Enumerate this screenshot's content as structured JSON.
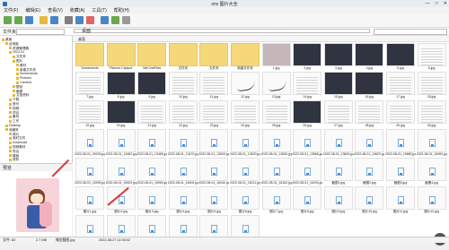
{
  "window": {
    "title": "xnv 图片大全",
    "minimize": "—",
    "maximize": "□",
    "close": "✕"
  },
  "menu": [
    "文件(F)",
    "编辑(E)",
    "查看(V)",
    "收藏(A)",
    "工具(T)",
    "帮助(H)"
  ],
  "address": {
    "label": "文件夹",
    "path": "桌面"
  },
  "tree": {
    "items": [
      "桌面",
      "此电脑",
      "资源管理器",
      "2022-01",
      "文件夹",
      "图片",
      "素材",
      "新建文件夹",
      "Screenshots",
      "Pictures",
      "Camera",
      "壁纸",
      "截图",
      "文档资料",
      "下载",
      "音乐",
      "视频",
      "项目",
      "备份",
      "工作",
      "Desktop",
      "收藏夹",
      "照片",
      "临时文件",
      "Download",
      "视频素材",
      "导出",
      "模板",
      "资料"
    ]
  },
  "preview": {
    "label": "预览"
  },
  "content": {
    "header": "桌面"
  },
  "files": [
    {
      "name": "Screenshots",
      "kind": "folder"
    },
    {
      "name": "Pictures Capture",
      "kind": "folder"
    },
    {
      "name": "WeChatFiles",
      "kind": "folder"
    },
    {
      "name": "文件夹",
      "kind": "folder"
    },
    {
      "name": "文件夹",
      "kind": "folder"
    },
    {
      "name": "新建文件夹",
      "kind": "folder"
    },
    {
      "name": "1.jpg",
      "kind": "photo"
    },
    {
      "name": "2.jpg",
      "kind": "dark"
    },
    {
      "name": "3.jpg",
      "kind": "dark"
    },
    {
      "name": "4.jpg",
      "kind": "dark"
    },
    {
      "name": "5.jpg",
      "kind": "dark"
    },
    {
      "name": "6.jpg",
      "kind": "light"
    },
    {
      "name": "7.jpg",
      "kind": "light"
    },
    {
      "name": "8.jpg",
      "kind": "dark"
    },
    {
      "name": "9.jpg",
      "kind": "dark"
    },
    {
      "name": "10.jpg",
      "kind": "light"
    },
    {
      "name": "11.jpg",
      "kind": "light"
    },
    {
      "name": "12.jpg",
      "kind": "sig"
    },
    {
      "name": "13.jpg",
      "kind": "sig"
    },
    {
      "name": "14.jpg",
      "kind": "light"
    },
    {
      "name": "15.jpg",
      "kind": "dark"
    },
    {
      "name": "16.jpg",
      "kind": "dark"
    },
    {
      "name": "17.jpg",
      "kind": "light"
    },
    {
      "name": "18.jpg",
      "kind": "light"
    },
    {
      "name": "19.jpg",
      "kind": "light"
    },
    {
      "name": "20.jpg",
      "kind": "dark"
    },
    {
      "name": "21.jpg",
      "kind": "light"
    },
    {
      "name": "22.jpg",
      "kind": "light"
    },
    {
      "name": "23.jpg",
      "kind": "light"
    },
    {
      "name": "24.jpg",
      "kind": "light"
    },
    {
      "name": "25.jpg",
      "kind": "light"
    },
    {
      "name": "26.jpg",
      "kind": "dark"
    },
    {
      "name": "27.jpg",
      "kind": "light"
    },
    {
      "name": "28.jpg",
      "kind": "light"
    },
    {
      "name": "29.jpg",
      "kind": "light"
    },
    {
      "name": "30.jpg",
      "kind": "light"
    },
    {
      "name": "2022-08-01_00024.jpg",
      "kind": "file"
    },
    {
      "name": "2022-08-01_13452.jpg",
      "kind": "file"
    },
    {
      "name": "2022-08-01_13455.jpg",
      "kind": "file"
    },
    {
      "name": "2022-08-01_13470.jpg",
      "kind": "file"
    },
    {
      "name": "2022-08-01_13503.jpg",
      "kind": "file"
    },
    {
      "name": "2022-08-01_13520.jpg",
      "kind": "file"
    },
    {
      "name": "2022-08-01_13530.jpg",
      "kind": "file"
    },
    {
      "name": "2022-08-01_13566.jpg",
      "kind": "file"
    },
    {
      "name": "2022-08-01_13600.jpg",
      "kind": "file"
    },
    {
      "name": "2022-08-01_13620.jpg",
      "kind": "file"
    },
    {
      "name": "2022-08-01_15880.jpg",
      "kind": "file"
    },
    {
      "name": "2022-08-01_15900.jpg",
      "kind": "file"
    },
    {
      "name": "2022-08-01_15900.jpg",
      "kind": "file"
    },
    {
      "name": "2022-08-01_15920.jpg",
      "kind": "file"
    },
    {
      "name": "2022-08-01_15960.jpg",
      "kind": "file"
    },
    {
      "name": "2022-08-01_16002.jpg",
      "kind": "file"
    },
    {
      "name": "2022-08-01_16040.jpg",
      "kind": "file"
    },
    {
      "name": "2022-08-01_16111.jpg",
      "kind": "file"
    },
    {
      "name": "2022-08-01_16152.jpg",
      "kind": "file"
    },
    {
      "name": "2022-08-01_16200.jpg",
      "kind": "file"
    },
    {
      "name": "截图1.jpg",
      "kind": "file"
    },
    {
      "name": "截图2.jpg",
      "kind": "file"
    },
    {
      "name": "截图3.jpg",
      "kind": "file"
    },
    {
      "name": "截图4.jpg",
      "kind": "file"
    },
    {
      "name": "图片1.jpg",
      "kind": "file"
    },
    {
      "name": "图片2.jpg",
      "kind": "file"
    },
    {
      "name": "图片3.jpg",
      "kind": "file"
    },
    {
      "name": "图片4.jpg",
      "kind": "file"
    },
    {
      "name": "图片5.jpg",
      "kind": "file"
    },
    {
      "name": "图片6.jpg",
      "kind": "file"
    },
    {
      "name": "图片7.jpg",
      "kind": "file"
    },
    {
      "name": "图片8.jpg",
      "kind": "file"
    },
    {
      "name": "图片9.jpg",
      "kind": "file"
    },
    {
      "name": "图片10.jpg",
      "kind": "file"
    },
    {
      "name": "图片11.jpg",
      "kind": "file"
    },
    {
      "name": "图片12.jpg",
      "kind": "file"
    },
    {
      "name": "微信截图.jpg",
      "kind": "file",
      "selected": true
    },
    {
      "name": "微信图片1.jpg",
      "kind": "file"
    },
    {
      "name": "微信图片2.jpg",
      "kind": "file"
    },
    {
      "name": "微信图片3.jpg",
      "kind": "file"
    },
    {
      "name": "微信图片4.jpg",
      "kind": "file"
    },
    {
      "name": "微信图片5.jpg",
      "kind": "file"
    }
  ],
  "status": {
    "left": "文件: 83",
    "size": "2.7 MB",
    "selected": "微信截图.jpg",
    "date": "2022-08-27 11:05:02"
  },
  "badge": {
    "text": "84"
  }
}
